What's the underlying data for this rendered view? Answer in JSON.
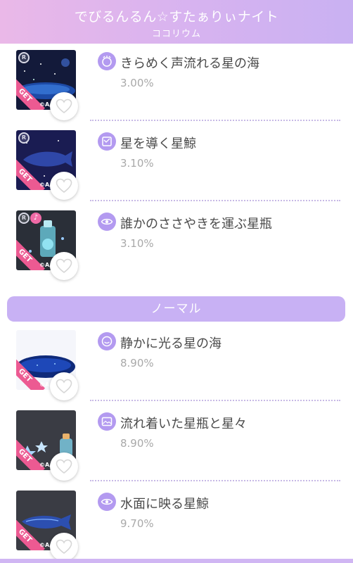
{
  "header": {
    "title": "でびるんるん☆すたぁりぃナイト",
    "subtitle": "ココリウム"
  },
  "rare_items": [
    {
      "name": "きらめく声流れる星の海",
      "rate": "3.00%",
      "icon": "sparkle-face-icon",
      "badge": "R",
      "get": "GET",
      "copyright": "©A/"
    },
    {
      "name": "星を導く星鯨",
      "rate": "3.10%",
      "icon": "frame-icon",
      "badge": "R",
      "get": "GET",
      "copyright": "©A/"
    },
    {
      "name": "誰かのささやきを運ぶ星瓶",
      "rate": "3.10%",
      "icon": "eye-icon",
      "badge": "R",
      "badge2": "♪",
      "get": "GET",
      "copyright": "©A/"
    }
  ],
  "section": {
    "label": "ノーマル"
  },
  "normal_items": [
    {
      "name": "静かに光る星の海",
      "rate": "8.90%",
      "icon": "smile-icon",
      "get": "GET",
      "copyright": "©A/"
    },
    {
      "name": "流れ着いた星瓶と星々",
      "rate": "8.90%",
      "icon": "picture-icon",
      "get": "GET",
      "copyright": "©A/"
    },
    {
      "name": "水面に映る星鯨",
      "rate": "9.70%",
      "icon": "eye-icon",
      "get": "GET",
      "copyright": "©A/"
    }
  ],
  "colors": {
    "accent": "#b39af0",
    "section_bar": "#c8b1f4",
    "get_ribbon": "#ec5a92"
  }
}
